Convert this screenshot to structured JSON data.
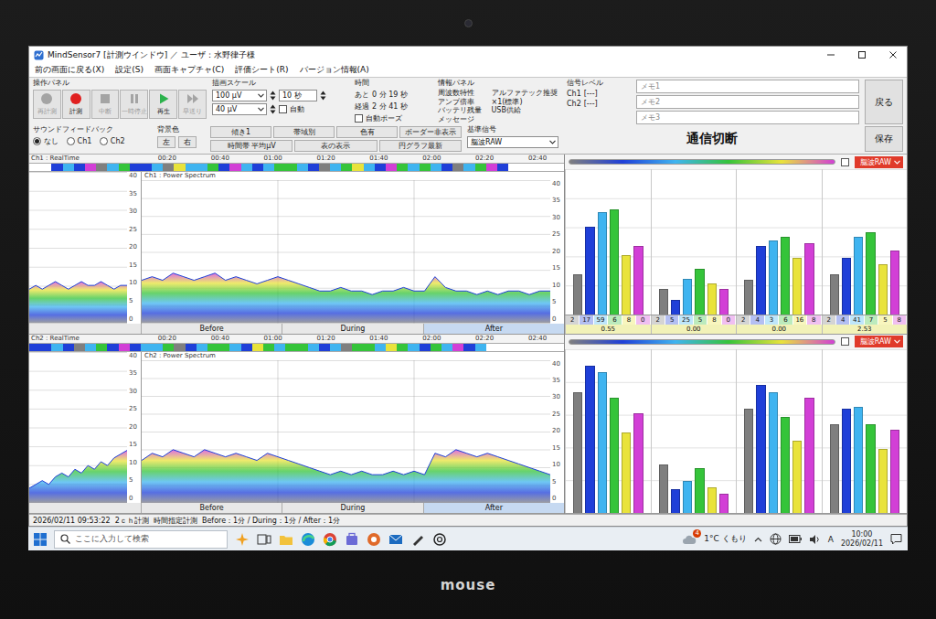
{
  "window": {
    "title": "MindSensor7 [計測ウインドウ] ／ ユーザ：水野律子様"
  },
  "menu": [
    "前の画面に戻る(X)",
    "設定(S)",
    "画面キャプチャ(C)",
    "評価シート(R)",
    "バージョン情報(A)"
  ],
  "operation_panel": {
    "label": "操作パネル",
    "buttons": [
      {
        "label": "再計測",
        "kind": "circle",
        "disabled": true
      },
      {
        "label": "計測",
        "kind": "record",
        "disabled": false
      },
      {
        "label": "中断",
        "kind": "stop",
        "disabled": true
      },
      {
        "label": "一時停止",
        "kind": "pause",
        "disabled": true
      },
      {
        "label": "再生",
        "kind": "play",
        "disabled": false
      },
      {
        "label": "早送り",
        "kind": "forward",
        "disabled": true
      }
    ]
  },
  "scale": {
    "label": "描画スケール",
    "amplitude": [
      "100 μV",
      "40 μV"
    ],
    "span": "10 秒",
    "auto": {
      "label": "自動",
      "checked": false
    }
  },
  "time": {
    "label": "時間",
    "rows": [
      {
        "name": "あと",
        "value": "0 分 19 秒"
      },
      {
        "name": "経過",
        "value": "2 分 41 秒"
      }
    ],
    "auto_pause": {
      "label": "自動ポーズ",
      "checked": false
    }
  },
  "info": {
    "label": "情報パネル",
    "rows": [
      {
        "name": "周波数特性",
        "value": "アルファテック推奨"
      },
      {
        "name": "アンプ倍率",
        "value": "×1(標準)"
      },
      {
        "name": "バッテリ残量",
        "value": "USB供給"
      }
    ],
    "message_label": "メッセージ"
  },
  "signal_level": {
    "label": "信号レベル",
    "channels": [
      {
        "name": "Ch1",
        "value": "[---]"
      },
      {
        "name": "Ch2",
        "value": "[---]"
      }
    ]
  },
  "memos": [
    {
      "placeholder": "メモ1"
    },
    {
      "placeholder": "メモ2"
    },
    {
      "placeholder": "メモ3"
    }
  ],
  "back_button": "戻る",
  "save_button": "保存",
  "sound_feedback": {
    "label": "サウンドフィードバック",
    "options": [
      {
        "label": "なし",
        "selected": true
      },
      {
        "label": "Ch1",
        "selected": false
      },
      {
        "label": "Ch2",
        "selected": false
      }
    ]
  },
  "background_color": {
    "label": "背景色",
    "buttons": [
      "左",
      "右"
    ]
  },
  "view_buttons": [
    [
      "傾き1",
      "帯域別",
      "色有",
      "ボーダー非表示"
    ],
    [
      "時間帯 平均μV",
      "表の表示",
      "円グラフ最新"
    ]
  ],
  "reference_signal": {
    "label": "基準信号",
    "value": "脳波RAW"
  },
  "connection_status": "通信切断",
  "bands": [
    {
      "color": "#7f7f7f"
    },
    {
      "color": "#1f3fd8"
    },
    {
      "color": "#3fb4f0"
    },
    {
      "color": "#35c43a"
    },
    {
      "color": "#e9e33b"
    },
    {
      "color": "#d23fd6"
    }
  ],
  "y_ticks": [
    "40",
    "35",
    "30",
    "25",
    "20",
    "15",
    "10",
    "5",
    "0"
  ],
  "time_ticks": [
    "00:20",
    "00:40",
    "01:00",
    "01:20",
    "01:40",
    "02:00",
    "02:20",
    "02:40"
  ],
  "phases": [
    {
      "label": "Before",
      "selected": false
    },
    {
      "label": "During",
      "selected": false
    },
    {
      "label": "After",
      "selected": true
    }
  ],
  "channels": [
    {
      "name": "Ch1",
      "realtime_label": "Ch1 : RealTime",
      "spectrum_label": "Ch1 : Power Spectrum",
      "strip": [
        -1,
        -1,
        1,
        2,
        1,
        5,
        0,
        2,
        3,
        1,
        1,
        2,
        0,
        4,
        2,
        2,
        3,
        1,
        5,
        2,
        1,
        2,
        3,
        3,
        2,
        1,
        0,
        2,
        3,
        4,
        2,
        1,
        5,
        3,
        2,
        3,
        2,
        1,
        0,
        2,
        3,
        5,
        1,
        -1,
        -1,
        -1,
        -1,
        -1
      ],
      "mini_series": [
        9,
        10,
        9,
        10,
        11,
        10,
        9,
        10,
        11,
        10,
        10,
        11,
        10,
        9,
        10,
        10
      ],
      "series": [
        12,
        13,
        12,
        14,
        13,
        12,
        13,
        14,
        12,
        13,
        12,
        11,
        12,
        13,
        12,
        11,
        10,
        9,
        9,
        10,
        9,
        9,
        8,
        9,
        9,
        10,
        9,
        9,
        13,
        10,
        9,
        9,
        8,
        9,
        8,
        9,
        9,
        8,
        9,
        9
      ],
      "panel": {
        "checked": false,
        "select": "脳波RAW"
      },
      "groups": [
        {
          "bars": [
            28,
            62,
            72,
            74,
            42,
            48
          ],
          "cells": [
            "2",
            "17",
            "59",
            "6",
            "8",
            "0"
          ],
          "ratio": "0.55"
        },
        {
          "bars": [
            18,
            10,
            25,
            32,
            22,
            18
          ],
          "cells": [
            "2",
            "5",
            "25",
            "5",
            "8",
            "0"
          ],
          "ratio": "0.00"
        },
        {
          "bars": [
            24,
            48,
            52,
            55,
            40,
            50
          ],
          "cells": [
            "2",
            "4",
            "3",
            "6",
            "16",
            "8"
          ],
          "ratio": "0.00"
        },
        {
          "bars": [
            28,
            40,
            55,
            58,
            35,
            45
          ],
          "cells": [
            "2",
            "4",
            "41",
            "7",
            "5",
            "8"
          ],
          "ratio": "2.53"
        }
      ]
    },
    {
      "name": "Ch2",
      "realtime_label": "Ch2 : RealTime",
      "spectrum_label": "Ch2 : Power Spectrum",
      "strip": [
        1,
        1,
        2,
        1,
        0,
        2,
        3,
        1,
        5,
        1,
        2,
        2,
        3,
        0,
        1,
        2,
        3,
        3,
        2,
        1,
        4,
        3,
        2,
        3,
        3,
        2,
        1,
        2,
        0,
        3,
        3,
        2,
        4,
        3,
        2,
        1,
        3,
        2,
        5,
        1,
        2,
        -1,
        -1,
        -1,
        -1,
        -1,
        -1,
        -1
      ],
      "mini_series": [
        4,
        5,
        6,
        5,
        7,
        8,
        7,
        9,
        8,
        10,
        9,
        11,
        10,
        12,
        13,
        14
      ],
      "series": [
        12,
        14,
        13,
        15,
        14,
        13,
        15,
        14,
        13,
        14,
        13,
        12,
        14,
        13,
        12,
        11,
        10,
        9,
        8,
        9,
        8,
        9,
        8,
        8,
        9,
        8,
        9,
        8,
        14,
        13,
        15,
        14,
        13,
        14,
        13,
        12,
        11,
        10,
        9,
        8
      ],
      "panel": {
        "checked": false,
        "select": "脳波RAW"
      },
      "groups": [
        {
          "bars": [
            75,
            92,
            88,
            72,
            50,
            62
          ]
        },
        {
          "bars": [
            30,
            15,
            20,
            28,
            16,
            12
          ]
        },
        {
          "bars": [
            65,
            80,
            75,
            60,
            45,
            72
          ]
        },
        {
          "bars": [
            55,
            65,
            66,
            55,
            40,
            52
          ]
        }
      ]
    }
  ],
  "status_bar": "2026/02/11 09:53:22  2ｃｈ計測  時間指定計測  Before：1分 / During：1分 / After：1分",
  "taskbar": {
    "search_placeholder": "ここに入力して検索",
    "weather": "1°C くもり",
    "weather_badge": "4",
    "ime": "A",
    "time": "10:00",
    "date": "2026/02/11"
  },
  "bezel": {
    "logo": "mouse"
  }
}
